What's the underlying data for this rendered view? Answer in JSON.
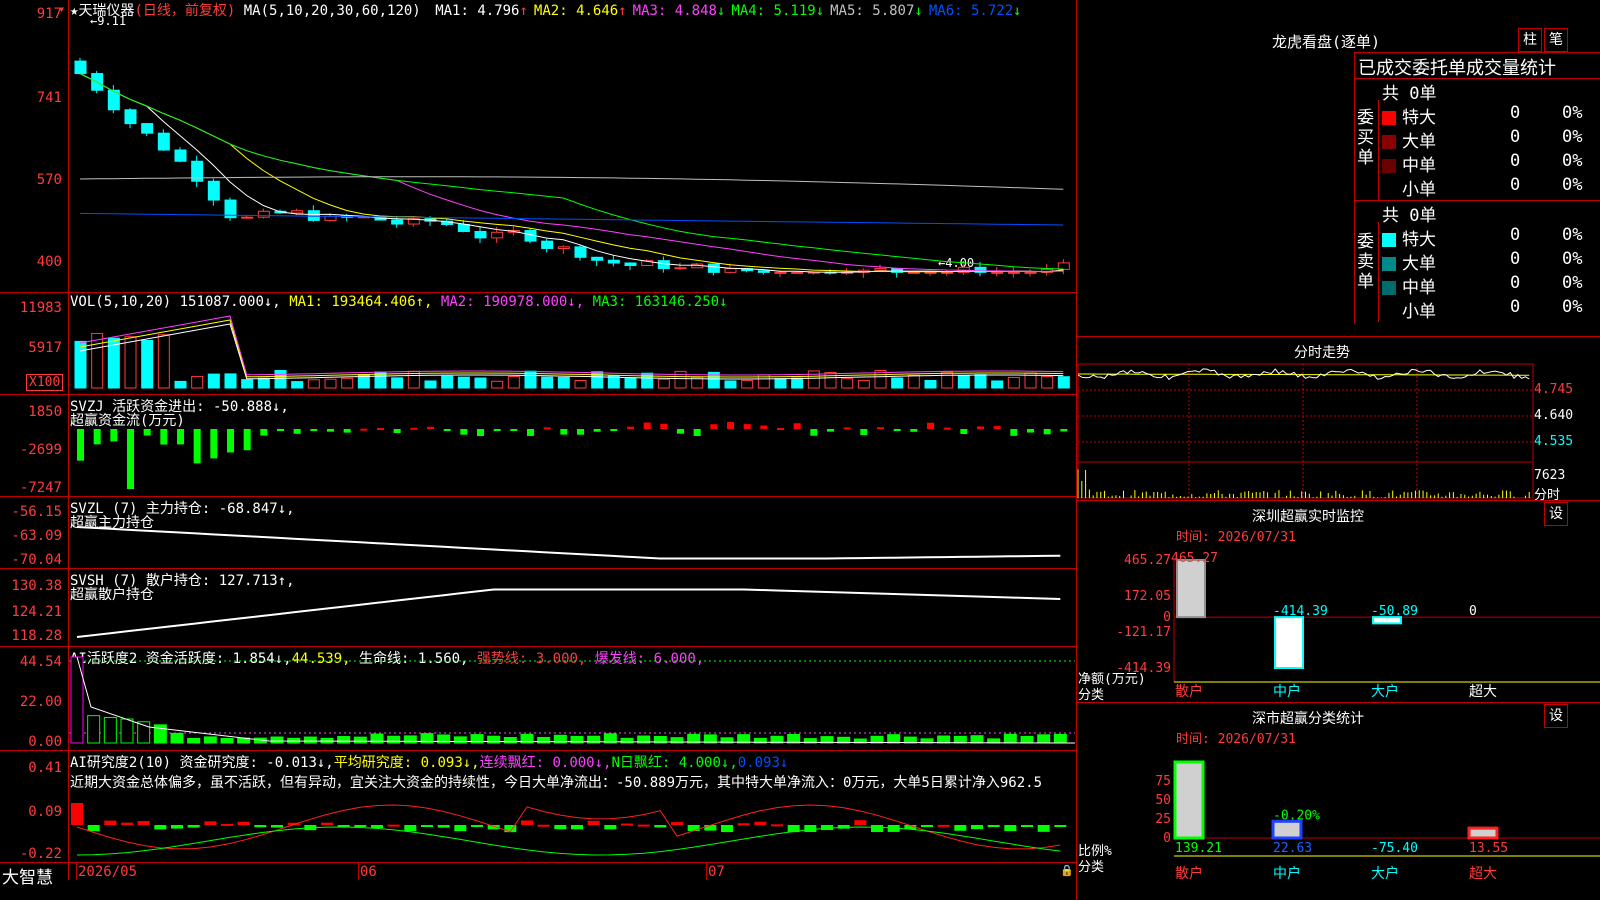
{
  "main": {
    "symbol": "天瑞仪器",
    "mode": "(日线，前复权)",
    "ma_label": "MA(5,10,20,30,60,120)",
    "ma": [
      {
        "name": "MA1:",
        "value": "4.796",
        "arrow": "↑",
        "color": "#ffffff"
      },
      {
        "name": "MA2:",
        "value": "4.646",
        "arrow": "↑",
        "color": "#ffff00"
      },
      {
        "name": "MA3:",
        "value": "4.848",
        "arrow": "↓",
        "color": "#ff40ff"
      },
      {
        "name": "MA4:",
        "value": "5.119",
        "arrow": "↓",
        "color": "#00ff00"
      },
      {
        "name": "MA5:",
        "value": "5.807",
        "arrow": "↓",
        "color": "#c0c0c0"
      },
      {
        "name": "MA6:",
        "value": "5.722",
        "arrow": "↓",
        "color": "#0050ff"
      }
    ],
    "y_ticks": [
      "917",
      "741",
      "570",
      "400"
    ],
    "high_mark": "9.11",
    "low_mark": "4.00"
  },
  "vol": {
    "label": "VOL(5,10,20)",
    "value": "151087.000↓,",
    "ma1": "MA1: 193464.406↑,",
    "ma2": "MA2: 190978.000↓,",
    "ma3": "MA3: 163146.250↓",
    "y_ticks": [
      "11983",
      "5917"
    ],
    "unit": "X100"
  },
  "svzj": {
    "label": "SVZJ  活跃资金进出: -50.888↓,",
    "sub": "超赢资金流(万元)",
    "y_ticks": [
      "1850",
      "-2699",
      "-7247"
    ]
  },
  "svzl": {
    "label": "SVZL (7) 主力持仓: -68.847↓,",
    "sub": "超赢主力持仓",
    "y_ticks": [
      "-56.15",
      "-63.09",
      "-70.04"
    ]
  },
  "svsh": {
    "label": "SVSH (7) 散户持仓: 127.713↑,",
    "sub": "超赢散户持仓",
    "y_ticks": [
      "130.38",
      "124.21",
      "118.28"
    ]
  },
  "ai1": {
    "name": "AI活跃度2",
    "p1": "资金活跃度: 1.854↓,",
    "p2": "44.539,",
    "p3": "生命线: 1.560,",
    "p4": "强势线: 3.000,",
    "p5": "爆发线: 6.000,",
    "y_ticks": [
      "44.54",
      "22.00",
      "0.00"
    ]
  },
  "ai2": {
    "name": "AI研究度2(10)",
    "p1": "资金研究度: -0.013↓,",
    "p2": "平均研究度: 0.093↓,",
    "p3": "连续飘红: 0.000↓,",
    "p4": "N日飘红: 4.000↓,",
    "p5": "0.093↓",
    "comment": "近期大资金总体偏多，虽不活跃，但有异动，宜关注大资金的持续性，今日大单净流出：-50.889万元，其中特大单净流入：0万元，大单5日累计净入962.5",
    "y_ticks": [
      "0.41",
      "0.09",
      "-0.22"
    ]
  },
  "xaxis": {
    "brand": "大智慧",
    "labels": [
      "2026/05",
      "06",
      "07"
    ]
  },
  "right": {
    "title": "龙虎看盘(逐单)",
    "btn1": "柱",
    "btn2": "笔",
    "header": "已成交委托单成交量统计",
    "buy": {
      "total": "共 0单",
      "side_label": "委买单",
      "rows": [
        {
          "color": "#ff0000",
          "name": "特大",
          "count": "0",
          "pct": "0%"
        },
        {
          "color": "#8b0000",
          "name": "大单",
          "count": "0",
          "pct": "0%"
        },
        {
          "color": "#6b0000",
          "name": "中单",
          "count": "0",
          "pct": "0%"
        },
        {
          "color": "#000000",
          "name": "小单",
          "count": "0",
          "pct": "0%"
        }
      ]
    },
    "sell": {
      "total": "共 0单",
      "side_label": "委卖单",
      "rows": [
        {
          "color": "#00ffff",
          "name": "特大",
          "count": "0",
          "pct": "0%"
        },
        {
          "color": "#008b8b",
          "name": "大单",
          "count": "0",
          "pct": "0%"
        },
        {
          "color": "#006b6b",
          "name": "中单",
          "count": "0",
          "pct": "0%"
        },
        {
          "color": "#000000",
          "name": "小单",
          "count": "0",
          "pct": "0%"
        }
      ]
    },
    "intraday": {
      "title": "分时走势",
      "y_ticks": [
        "4.745",
        "4.640",
        "4.535"
      ],
      "vol_top": "7623",
      "vol_unit": "分时"
    },
    "monitor": {
      "title": "深圳超赢实时监控",
      "btn": "设",
      "time": "时间: 2026/07/31",
      "y_ticks": [
        "465.27",
        "172.05",
        "0",
        "-121.17",
        "-414.39"
      ],
      "ylabel1": "净额(万元)",
      "ylabel2": "分类",
      "bars": [
        {
          "cat": "散户",
          "value": "465.27",
          "v": 465.27
        },
        {
          "cat": "中户",
          "value": "-414.39",
          "v": -414.39
        },
        {
          "cat": "大户",
          "value": "-50.89",
          "v": -50.89
        },
        {
          "cat": "超大",
          "value": "0",
          "v": 0
        }
      ]
    },
    "classify": {
      "title": "深市超赢分类统计",
      "btn": "设",
      "time": "时间: 2026/07/31",
      "y_ticks": [
        "75",
        "50",
        "25",
        "0"
      ],
      "ylabel1": "比例%",
      "ylabel2": "分类",
      "pct_label": "-0.20%",
      "bars": [
        {
          "cat": "散户",
          "value": "139.21",
          "pct": 100
        },
        {
          "cat": "中户",
          "value": "22.63",
          "pct": 22
        },
        {
          "cat": "大户",
          "value": "-75.40",
          "pct": 0
        },
        {
          "cat": "超大",
          "value": "13.55",
          "pct": 13
        }
      ]
    }
  }
}
